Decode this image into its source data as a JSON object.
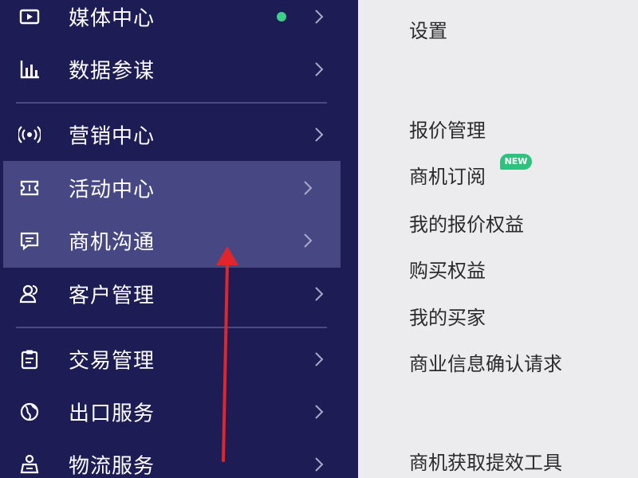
{
  "sidebar": {
    "items": [
      {
        "label": "媒体中心",
        "icon": "video-icon"
      },
      {
        "label": "数据参谋",
        "icon": "bar-chart-icon"
      },
      {
        "label": "营销中心",
        "icon": "broadcast-icon"
      },
      {
        "label": "活动中心",
        "icon": "ticket-icon"
      },
      {
        "label": "商机沟通",
        "icon": "message-icon"
      },
      {
        "label": "客户管理",
        "icon": "users-icon"
      },
      {
        "label": "交易管理",
        "icon": "clipboard-icon"
      },
      {
        "label": "出口服务",
        "icon": "globe-icon"
      },
      {
        "label": "物流服务",
        "icon": "truck-icon"
      }
    ],
    "active_item": "商机沟通",
    "notification_color": "#3ccf8a",
    "background_color": "#1d1c55"
  },
  "submenu": {
    "settings_label": "设置",
    "sections": [
      {
        "items": [
          "报价管理",
          "商机订阅",
          "我的报价权益",
          "购买权益",
          "我的买家",
          "商业信息确认请求"
        ]
      },
      {
        "items": [
          "商机获取提效工具"
        ]
      }
    ],
    "new_badge": "NEW",
    "badge_color": "#2ec27e"
  },
  "annotation": {
    "arrow_color": "#e0252b"
  }
}
